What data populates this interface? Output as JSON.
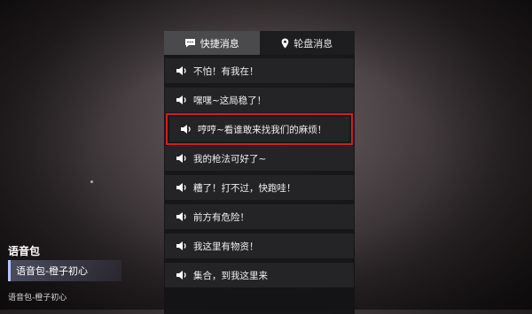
{
  "tabs": [
    {
      "label": "快捷消息",
      "icon": "chat-bubble-icon",
      "active": true
    },
    {
      "label": "轮盘消息",
      "icon": "location-pin-icon",
      "active": false
    }
  ],
  "messages": [
    {
      "text": "不怕！有我在！"
    },
    {
      "text": "嘿嘿~这局稳了！"
    },
    {
      "text": "哼哼~看谁敢来找我们的麻烦！",
      "selected": true
    },
    {
      "text": "我的枪法可好了~"
    },
    {
      "text": "糟了！打不过，快跑哇！"
    },
    {
      "text": "前方有危险！"
    },
    {
      "text": "我这里有物资！"
    },
    {
      "text": "集合，到我这里来"
    }
  ],
  "voice_pack": {
    "heading": "语音包",
    "selected": "语音包-橙子初心",
    "current": "语音包-橙子初心"
  },
  "colors": {
    "highlight": "#d21e1e",
    "active_tab": "#4a4a4d",
    "item_bg": "#242426"
  }
}
